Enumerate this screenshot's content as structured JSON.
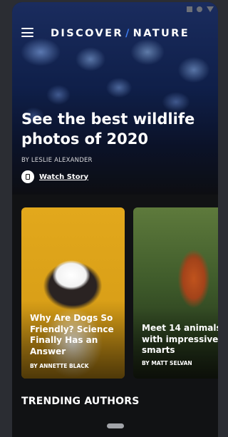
{
  "app": {
    "brand_left": "DISCOVER",
    "brand_sep": "/",
    "brand_right": "NATURE",
    "menu_icon": "hamburger-menu-icon"
  },
  "status_bar": {
    "icons": [
      "square-icon",
      "circle-icon",
      "triangle-icon"
    ]
  },
  "hero": {
    "title": "See the best wildlife photos of 2020",
    "byline": "BY LESLIE ALEXANDER",
    "watch_label": "Watch Story",
    "watch_icon": "book-icon",
    "image": "jellyfish-photo"
  },
  "cards": [
    {
      "title": "Why Are Dogs So Friendly? Science Finally Has an Answer",
      "author": "BY ANNETTE BLACK",
      "image": "dog-photo"
    },
    {
      "title": "Meet 14 animals with impressive smarts",
      "author": "BY MATT SELVAN",
      "image": "orangutan-photo"
    }
  ],
  "sections": {
    "trending_title": "TRENDING AUTHORS"
  },
  "colors": {
    "background": "#2b2d33",
    "screen": "#111214",
    "accent": "#3d7df2",
    "text": "#ffffff"
  }
}
